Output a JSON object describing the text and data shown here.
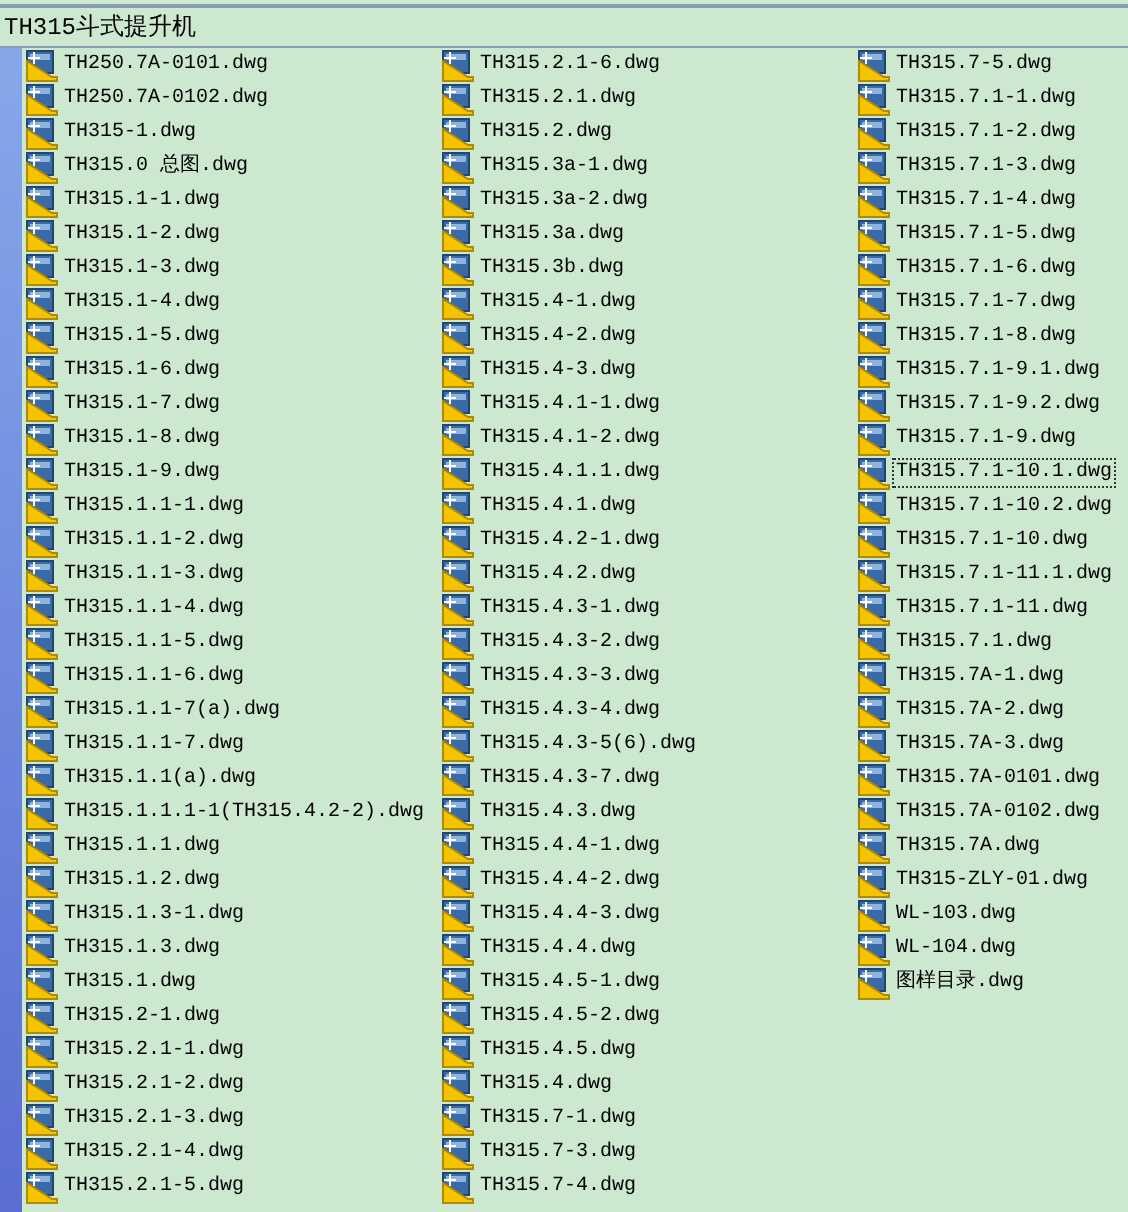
{
  "window": {
    "title": "TH315斗式提升机"
  },
  "files": [
    {
      "name": "TH250.7A-0101.dwg",
      "focused": false
    },
    {
      "name": "TH250.7A-0102.dwg",
      "focused": false
    },
    {
      "name": "TH315-1.dwg",
      "focused": false
    },
    {
      "name": "TH315.0 总图.dwg",
      "focused": false
    },
    {
      "name": "TH315.1-1.dwg",
      "focused": false
    },
    {
      "name": "TH315.1-2.dwg",
      "focused": false
    },
    {
      "name": "TH315.1-3.dwg",
      "focused": false
    },
    {
      "name": "TH315.1-4.dwg",
      "focused": false
    },
    {
      "name": "TH315.1-5.dwg",
      "focused": false
    },
    {
      "name": "TH315.1-6.dwg",
      "focused": false
    },
    {
      "name": "TH315.1-7.dwg",
      "focused": false
    },
    {
      "name": "TH315.1-8.dwg",
      "focused": false
    },
    {
      "name": "TH315.1-9.dwg",
      "focused": false
    },
    {
      "name": "TH315.1.1-1.dwg",
      "focused": false
    },
    {
      "name": "TH315.1.1-2.dwg",
      "focused": false
    },
    {
      "name": "TH315.1.1-3.dwg",
      "focused": false
    },
    {
      "name": "TH315.1.1-4.dwg",
      "focused": false
    },
    {
      "name": "TH315.1.1-5.dwg",
      "focused": false
    },
    {
      "name": "TH315.1.1-6.dwg",
      "focused": false
    },
    {
      "name": "TH315.1.1-7(a).dwg",
      "focused": false
    },
    {
      "name": "TH315.1.1-7.dwg",
      "focused": false
    },
    {
      "name": "TH315.1.1(a).dwg",
      "focused": false
    },
    {
      "name": "TH315.1.1.1-1(TH315.4.2-2).dwg",
      "focused": false
    },
    {
      "name": "TH315.1.1.dwg",
      "focused": false
    },
    {
      "name": "TH315.1.2.dwg",
      "focused": false
    },
    {
      "name": "TH315.1.3-1.dwg",
      "focused": false
    },
    {
      "name": "TH315.1.3.dwg",
      "focused": false
    },
    {
      "name": "TH315.1.dwg",
      "focused": false
    },
    {
      "name": "TH315.2-1.dwg",
      "focused": false
    },
    {
      "name": "TH315.2.1-1.dwg",
      "focused": false
    },
    {
      "name": "TH315.2.1-2.dwg",
      "focused": false
    },
    {
      "name": "TH315.2.1-3.dwg",
      "focused": false
    },
    {
      "name": "TH315.2.1-4.dwg",
      "focused": false
    },
    {
      "name": "TH315.2.1-5.dwg",
      "focused": false
    },
    {
      "name": "TH315.2.1-6.dwg",
      "focused": false
    },
    {
      "name": "TH315.2.1.dwg",
      "focused": false
    },
    {
      "name": "TH315.2.dwg",
      "focused": false
    },
    {
      "name": "TH315.3a-1.dwg",
      "focused": false
    },
    {
      "name": "TH315.3a-2.dwg",
      "focused": false
    },
    {
      "name": "TH315.3a.dwg",
      "focused": false
    },
    {
      "name": "TH315.3b.dwg",
      "focused": false
    },
    {
      "name": "TH315.4-1.dwg",
      "focused": false
    },
    {
      "name": "TH315.4-2.dwg",
      "focused": false
    },
    {
      "name": "TH315.4-3.dwg",
      "focused": false
    },
    {
      "name": "TH315.4.1-1.dwg",
      "focused": false
    },
    {
      "name": "TH315.4.1-2.dwg",
      "focused": false
    },
    {
      "name": "TH315.4.1.1.dwg",
      "focused": false
    },
    {
      "name": "TH315.4.1.dwg",
      "focused": false
    },
    {
      "name": "TH315.4.2-1.dwg",
      "focused": false
    },
    {
      "name": "TH315.4.2.dwg",
      "focused": false
    },
    {
      "name": "TH315.4.3-1.dwg",
      "focused": false
    },
    {
      "name": "TH315.4.3-2.dwg",
      "focused": false
    },
    {
      "name": "TH315.4.3-3.dwg",
      "focused": false
    },
    {
      "name": "TH315.4.3-4.dwg",
      "focused": false
    },
    {
      "name": "TH315.4.3-5(6).dwg",
      "focused": false
    },
    {
      "name": "TH315.4.3-7.dwg",
      "focused": false
    },
    {
      "name": "TH315.4.3.dwg",
      "focused": false
    },
    {
      "name": "TH315.4.4-1.dwg",
      "focused": false
    },
    {
      "name": "TH315.4.4-2.dwg",
      "focused": false
    },
    {
      "name": "TH315.4.4-3.dwg",
      "focused": false
    },
    {
      "name": "TH315.4.4.dwg",
      "focused": false
    },
    {
      "name": "TH315.4.5-1.dwg",
      "focused": false
    },
    {
      "name": "TH315.4.5-2.dwg",
      "focused": false
    },
    {
      "name": "TH315.4.5.dwg",
      "focused": false
    },
    {
      "name": "TH315.4.dwg",
      "focused": false
    },
    {
      "name": "TH315.7-1.dwg",
      "focused": false
    },
    {
      "name": "TH315.7-3.dwg",
      "focused": false
    },
    {
      "name": "TH315.7-4.dwg",
      "focused": false
    },
    {
      "name": "TH315.7-5.dwg",
      "focused": false
    },
    {
      "name": "TH315.7.1-1.dwg",
      "focused": false
    },
    {
      "name": "TH315.7.1-2.dwg",
      "focused": false
    },
    {
      "name": "TH315.7.1-3.dwg",
      "focused": false
    },
    {
      "name": "TH315.7.1-4.dwg",
      "focused": false
    },
    {
      "name": "TH315.7.1-5.dwg",
      "focused": false
    },
    {
      "name": "TH315.7.1-6.dwg",
      "focused": false
    },
    {
      "name": "TH315.7.1-7.dwg",
      "focused": false
    },
    {
      "name": "TH315.7.1-8.dwg",
      "focused": false
    },
    {
      "name": "TH315.7.1-9.1.dwg",
      "focused": false
    },
    {
      "name": "TH315.7.1-9.2.dwg",
      "focused": false
    },
    {
      "name": "TH315.7.1-9.dwg",
      "focused": false
    },
    {
      "name": "TH315.7.1-10.1.dwg",
      "focused": true
    },
    {
      "name": "TH315.7.1-10.2.dwg",
      "focused": false
    },
    {
      "name": "TH315.7.1-10.dwg",
      "focused": false
    },
    {
      "name": "TH315.7.1-11.1.dwg",
      "focused": false
    },
    {
      "name": "TH315.7.1-11.dwg",
      "focused": false
    },
    {
      "name": "TH315.7.1.dwg",
      "focused": false
    },
    {
      "name": "TH315.7A-1.dwg",
      "focused": false
    },
    {
      "name": "TH315.7A-2.dwg",
      "focused": false
    },
    {
      "name": "TH315.7A-3.dwg",
      "focused": false
    },
    {
      "name": "TH315.7A-0101.dwg",
      "focused": false
    },
    {
      "name": "TH315.7A-0102.dwg",
      "focused": false
    },
    {
      "name": "TH315.7A.dwg",
      "focused": false
    },
    {
      "name": "TH315-ZLY-01.dwg",
      "focused": false
    },
    {
      "name": "WL-103.dwg",
      "focused": false
    },
    {
      "name": "WL-104.dwg",
      "focused": false
    },
    {
      "name": "图样目录.dwg",
      "focused": false
    }
  ]
}
